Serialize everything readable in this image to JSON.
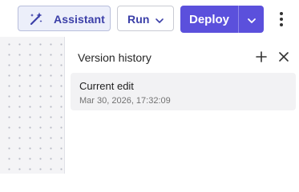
{
  "toolbar": {
    "assistant_label": "Assistant",
    "assistant_icon": "magic-wand-icon",
    "run_label": "Run",
    "run_icon": "chevron-down-icon",
    "deploy_label": "Deploy",
    "deploy_menu_icon": "chevron-down-icon",
    "more_icon": "more-vertical-icon"
  },
  "panel": {
    "title": "Version history",
    "add_icon": "plus-icon",
    "close_icon": "close-icon",
    "versions": [
      {
        "name": "Current edit",
        "timestamp": "Mar 30, 2026, 17:32:09"
      }
    ]
  },
  "colors": {
    "accent": "#5b50dc",
    "accent_text": "#3b3fa8",
    "assistant_bg": "#eceffa",
    "item_bg": "#f2f2f4",
    "canvas_bg": "#f4f4f6"
  }
}
